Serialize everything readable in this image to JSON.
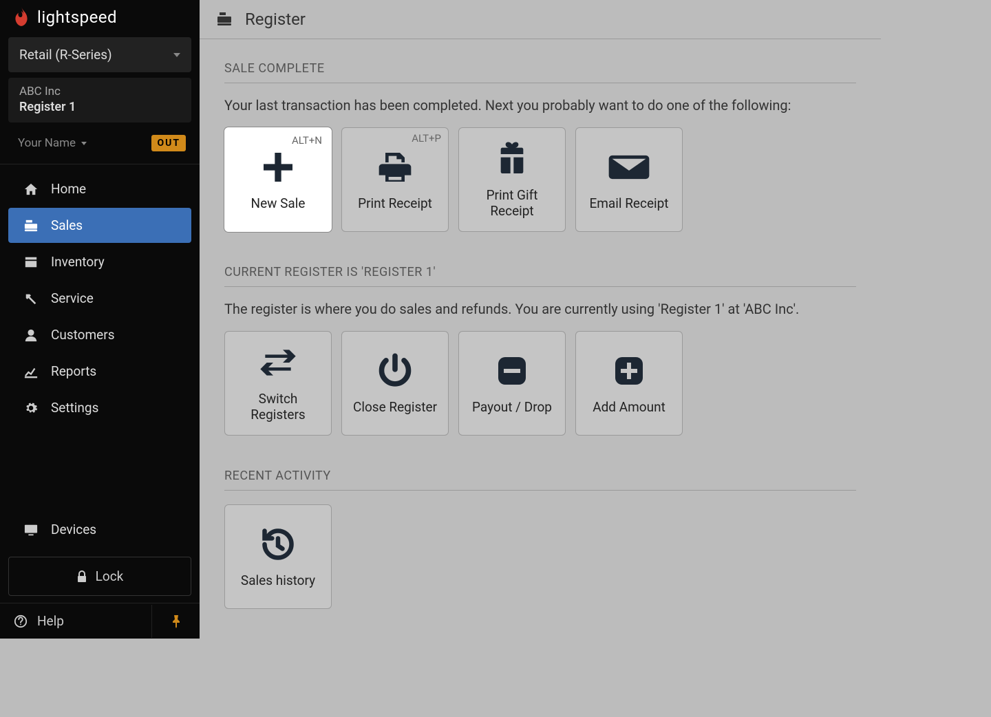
{
  "brand": "lightspeed",
  "product_selector": "Retail (R-Series)",
  "account": {
    "company": "ABC Inc",
    "register": "Register 1"
  },
  "user": {
    "name": "Your Name",
    "status_badge": "OUT"
  },
  "nav": [
    {
      "label": "Home"
    },
    {
      "label": "Sales"
    },
    {
      "label": "Inventory"
    },
    {
      "label": "Service"
    },
    {
      "label": "Customers"
    },
    {
      "label": "Reports"
    },
    {
      "label": "Settings"
    }
  ],
  "devices_label": "Devices",
  "lock_label": "Lock",
  "help_label": "Help",
  "page": {
    "title": "Register",
    "sections": {
      "sale_complete": {
        "heading": "SALE COMPLETE",
        "desc": "Your last transaction has been completed. Next you probably want to do one of the following:",
        "cards": [
          {
            "label": "New Sale",
            "shortcut": "ALT+N"
          },
          {
            "label": "Print Receipt",
            "shortcut": "ALT+P"
          },
          {
            "label": "Print Gift Receipt",
            "shortcut": ""
          },
          {
            "label": "Email Receipt",
            "shortcut": ""
          }
        ]
      },
      "current_register": {
        "heading": "CURRENT REGISTER IS 'REGISTER 1'",
        "desc": "The register is where you do sales and refunds. You are currently using 'Register 1'  at 'ABC Inc'.",
        "cards": [
          {
            "label": "Switch Registers"
          },
          {
            "label": "Close Register"
          },
          {
            "label": "Payout / Drop"
          },
          {
            "label": "Add Amount"
          }
        ]
      },
      "recent_activity": {
        "heading": "RECENT ACTIVITY",
        "cards": [
          {
            "label": "Sales history"
          }
        ]
      }
    }
  }
}
